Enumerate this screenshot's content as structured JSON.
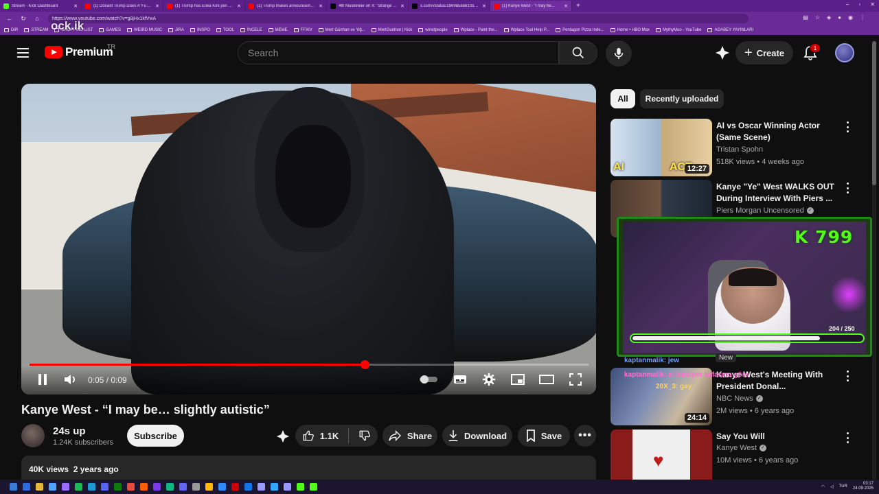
{
  "browser": {
    "tabs": [
      {
        "title": "Stream - Kick Dashboard",
        "color": "#53fc18"
      },
      {
        "title": "(1) Donald Trump Does A 'Funny...",
        "color": "#ff0000"
      },
      {
        "title": "(1) Trump has Erika Kirk join him...",
        "color": "#ff0000"
      },
      {
        "title": "(1) Trump makes announceme...",
        "color": "#ff0000"
      },
      {
        "title": "4th Musketeer on X: \"strange dis...",
        "color": "#000000"
      },
      {
        "title": "x.com/i/status/19698588610343...",
        "color": "#000000"
      },
      {
        "title": "(1) Kanye West - \"I may be...",
        "color": "#ff0000"
      }
    ],
    "new_tab": "+",
    "url": "https://www.youtube.com/watch?v=g8jHx1kfVwA",
    "watermark": "ock.ik",
    "bookmarks": [
      "DIR",
      "STREAM",
      "SHOPPING LIST",
      "GAMES",
      "WEIRD MUSIC",
      "JIRA",
      "INSPO",
      "TOOL",
      "İNCELE",
      "MEME",
      "FFXIV",
      "Mert Günhan ve Yiğ...",
      "MertGunhan | Kick",
      "wiredpeople",
      "Wplace - Paint the...",
      "Wplace Tool Help P...",
      "Pentagon Pizza Inde...",
      "Home • HBO Max",
      "MythyMoo - YouTube",
      "AGABEY YAYINLARI"
    ]
  },
  "header": {
    "logo": "Premium",
    "region": "TR",
    "search_placeholder": "Search",
    "create_label": "Create",
    "notif_count": "1"
  },
  "player": {
    "time": "0:05 / 0:09",
    "progress": 0.6
  },
  "video": {
    "title": "Kanye West - “I may be… slightly autistic”",
    "channel": "24s up",
    "subscribers": "1.24K subscribers",
    "subscribe_label": "Subscribe",
    "likes": "1.1K",
    "share_label": "Share",
    "download_label": "Download",
    "save_label": "Save",
    "views": "40K views",
    "age": "2 years ago"
  },
  "chips": [
    "All",
    "Recently uploaded"
  ],
  "recommendations": [
    {
      "title": "AI vs Oscar Winning Actor (Same Scene)",
      "channel": "Tristan Spohn",
      "meta": "518K views • 4 weeks ago",
      "duration": "12:27",
      "verified": false
    },
    {
      "title": "Kanye \"Ye\" West WALKS OUT During Interview With Piers ...",
      "channel": "Piers Morgan Uncensored",
      "meta": "",
      "duration": "",
      "verified": true
    },
    {
      "title": "Kanye West's Meeting With President Donal...",
      "channel": "NBC News",
      "meta": "2M views • 6 years ago",
      "duration": "24:14",
      "verified": true
    },
    {
      "title": "Say You Will",
      "channel": "Kanye West",
      "meta": "10M views • 6 years ago",
      "duration": "",
      "verified": true
    }
  ],
  "overlay": {
    "kick_count": "K 799",
    "goal_text": "204 / 250",
    "goal_progress": 0.816,
    "chat_line1": "kaptanmalik: jew",
    "chat_line2": "kaptanmalik: ai banlıyor kafasına göre",
    "chat_line3": "20X_3: gay",
    "new_label": "New"
  },
  "taskbar": {
    "lang": "TUR",
    "time": "03:17",
    "date": "24.09.2025"
  }
}
